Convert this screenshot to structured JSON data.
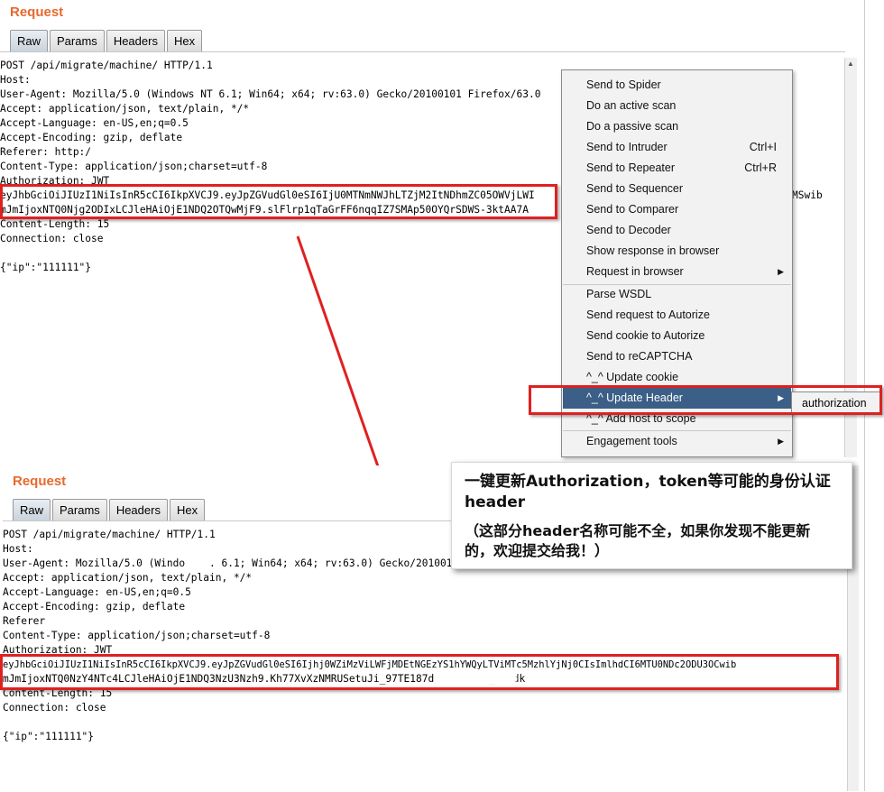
{
  "top": {
    "title": "Request",
    "tabs": [
      "Raw",
      "Params",
      "Headers",
      "Hex"
    ],
    "lines": [
      "POST /api/migrate/machine/ HTTP/1.1",
      "Host:",
      "User-Agent: Mozilla/5.0 (Windows NT 6.1; Win64; x64; rv:63.0) Gecko/20100101 Firefox/63.0",
      "Accept: application/json, text/plain, */*",
      "Accept-Language: en-US,en;q=0.5",
      "Accept-Encoding: gzip, deflate",
      "Referer: http:/",
      "Content-Type: application/json;charset=utf-8",
      "Authorization: JWT",
      "eyJhbGciOiJIUzI1NiIsInR5cCI6IkpXVCJ9.eyJpZGVudGl0eSI6IjU0MTNmNWJhLTZjM2ItNDhmZC05OWVjLWI",
      "mJmIjoxNTQ0Njg2ODIxLCJleHAiOjE1NDQ2OTQwMjF9.slFlrp1qTaGrFF6nqqIZ7SMAp50OYQrSDWS-3ktAA7A",
      "Content-Length: 15",
      "Connection: close",
      "",
      "{\"ip\":\"111111\"}"
    ],
    "token_tail": "MSwib"
  },
  "context_menu": {
    "items": [
      {
        "label": "Send to Spider",
        "shortcut": "",
        "submenu": false
      },
      {
        "label": "Do an active scan",
        "shortcut": "",
        "submenu": false
      },
      {
        "label": "Do a passive scan",
        "shortcut": "",
        "submenu": false
      },
      {
        "label": "Send to Intruder",
        "shortcut": "Ctrl+I",
        "submenu": false
      },
      {
        "label": "Send to Repeater",
        "shortcut": "Ctrl+R",
        "submenu": false
      },
      {
        "label": "Send to Sequencer",
        "shortcut": "",
        "submenu": false
      },
      {
        "label": "Send to Comparer",
        "shortcut": "",
        "submenu": false
      },
      {
        "label": "Send to Decoder",
        "shortcut": "",
        "submenu": false
      },
      {
        "label": "Show response in browser",
        "shortcut": "",
        "submenu": false
      },
      {
        "label": "Request in browser",
        "shortcut": "",
        "submenu": true
      },
      {
        "label": "Parse WSDL",
        "shortcut": "",
        "submenu": false
      },
      {
        "label": "Send request to Autorize",
        "shortcut": "",
        "submenu": false
      },
      {
        "label": "Send cookie to Autorize",
        "shortcut": "",
        "submenu": false
      },
      {
        "label": "Send to reCAPTCHA",
        "shortcut": "",
        "submenu": false
      },
      {
        "label": "^_^ Update cookie",
        "shortcut": "",
        "submenu": false
      },
      {
        "label": "^_^ Update Header",
        "shortcut": "",
        "submenu": true
      },
      {
        "label": "^_^ Add host to scope",
        "shortcut": "",
        "submenu": false
      },
      {
        "label": "Engagement tools",
        "shortcut": "",
        "submenu": true
      }
    ],
    "highlighted": "^_^ Update Header",
    "submenu_item": "authorization",
    "highlight_color": "#3b5f86"
  },
  "bottom": {
    "title": "Request",
    "tabs": [
      "Raw",
      "Params",
      "Headers",
      "Hex"
    ],
    "lines": [
      "POST /api/migrate/machine/ HTTP/1.1",
      "Host:",
      "User-Agent: Mozilla/5.0 (Windo    . 6.1; Win64; x64; rv:63.0) Gecko/20100101 Firefox/63.0",
      "Accept: application/json, text/plain, */*",
      "Accept-Language: en-US,en;q=0.5",
      "Accept-Encoding: gzip, deflate",
      "Referer",
      "Content-Type: application/json;charset=utf-8",
      "Authorization: JWT",
      "eyJhbGciOiJIUzI1NiIsInR5cCI6IkpXVCJ9.eyJpZGVudGl0eSI6Ijhj0WZiMzViLWFjMDEtNGEzYS1hYWQyLTViMTc5MzhlYjNj0CIsImlhdCI6MTU0NDc2ODU3OCwib",
      "mJmIjoxNTQ0NzY4NTc4LCJleHAiOjE1NDQ3NzU3Nzh9.Kh77XvXzNMRUSetuJi_97TE187d        3_8zNdk",
      "Content-Length: 15",
      "Connection: close",
      "",
      "{\"ip\":\"111111\"}"
    ]
  },
  "note": {
    "line1": "一键更新Authorization，token等可能的身份认证header",
    "line2": "（这部分header名称可能不全，如果你发现不能更新的，欢迎提交给我！）"
  },
  "colors": {
    "accent": "#e8692e",
    "annotation": "#e02020"
  }
}
